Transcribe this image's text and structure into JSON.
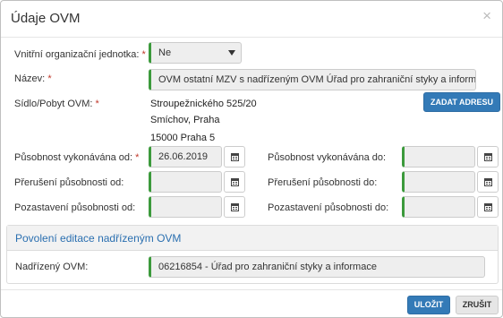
{
  "dialog": {
    "title": "Údaje OVM",
    "close_symbol": "×"
  },
  "form": {
    "vnitrni_label": "Vnitřní organizační jednotka:",
    "vnitrni_value": "Ne",
    "nazev_label": "Název:",
    "nazev_value": "OVM ostatní MZV s nadřízeným OVM Úřad pro zahraniční styky a informace",
    "sidlo_label": "Sídlo/Pobyt OVM:",
    "address_lines": [
      "Stroupežnického 525/20",
      "Smíchov, Praha",
      "15000 Praha 5"
    ],
    "zadat_adresu_label": "ZADAT ADRESU",
    "pusobnost_od_label": "Působnost vykonávána od:",
    "pusobnost_od_value": "26.06.2019",
    "pusobnost_do_label": "Působnost vykonávána do:",
    "pusobnost_do_value": "",
    "preruseni_od_label": "Přerušení působnosti od:",
    "preruseni_od_value": "",
    "preruseni_do_label": "Přerušení působnosti do:",
    "preruseni_do_value": "",
    "pozastaveni_od_label": "Pozastavení působnosti od:",
    "pozastaveni_od_value": "",
    "pozastaveni_do_label": "Pozastavení působnosti do:",
    "pozastaveni_do_value": "",
    "required_mark": "*"
  },
  "section": {
    "title": "Povolení editace nadřízeným OVM",
    "nadrizeny_label": "Nadřízený OVM:",
    "nadrizeny_value": "06216854 - Úřad pro zahraniční styky a informace"
  },
  "footer": {
    "ulozit_label": "ULOŽIT",
    "zrusit_label": "ZRUŠIT"
  },
  "colors": {
    "accent_blue": "#337ab7",
    "valid_green": "#3c9a3c",
    "required_red": "#c0392b",
    "section_title": "#2a6fb0"
  },
  "icons": {
    "calendar": "calendar-icon",
    "close": "close-icon",
    "caret": "chevron-down-icon"
  }
}
